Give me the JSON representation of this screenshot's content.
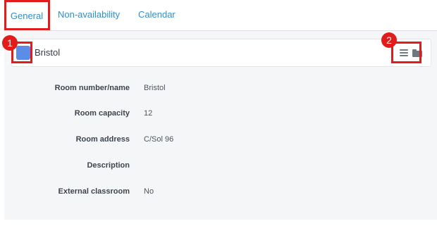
{
  "tabs": [
    {
      "label": "General",
      "active": true
    },
    {
      "label": "Non-availability",
      "active": false
    },
    {
      "label": "Calendar",
      "active": false
    }
  ],
  "room": {
    "title": "Bristol",
    "color": "#5b8de8"
  },
  "header_icons": [
    "list-icon",
    "folder-icon"
  ],
  "details": [
    {
      "label": "Room number/name",
      "value": "Bristol"
    },
    {
      "label": "Room capacity",
      "value": "12"
    },
    {
      "label": "Room address",
      "value": "C/Sol 96"
    },
    {
      "label": "Description",
      "value": ""
    },
    {
      "label": "External classroom",
      "value": "No"
    }
  ],
  "annotations": [
    {
      "number": "1"
    },
    {
      "number": "2"
    }
  ],
  "colors": {
    "accent": "#2e8fd0",
    "callout": "#e21b1b",
    "panel_bg": "#f5f6f7"
  }
}
